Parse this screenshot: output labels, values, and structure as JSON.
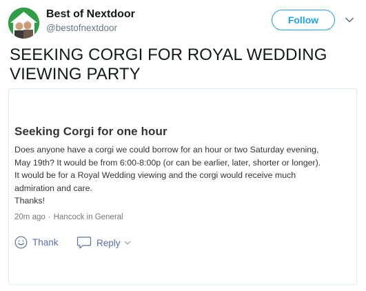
{
  "account": {
    "name": "Best of Nextdoor",
    "handle": "@bestofnextdoor",
    "follow_label": "Follow",
    "avatar_icon": "couple-photo-avatar",
    "caret_icon": "chevron-down-icon"
  },
  "tweet": {
    "text": "SEEKING CORGI FOR ROYAL WEDDING VIEWING PARTY"
  },
  "post": {
    "title": "Seeking Corgi for one hour",
    "body_lines": [
      "Does anyone have a corgi we could borrow for an hour or two Saturday evening,",
      "May 19th? It would be from 6:00-8:00p (or can be earlier, later, shorter or longer).",
      "It would be for a Royal Wedding viewing and the corgi would receive much",
      "admiration and care.",
      "Thanks!"
    ],
    "time": "20m ago",
    "separator": "·",
    "location": "Hancock in General",
    "thank_label": "Thank",
    "reply_label": "Reply",
    "thank_icon": "smiley-icon",
    "reply_icon": "speech-bubble-icon"
  },
  "colors": {
    "twitter_blue": "#1da1f2",
    "nextdoor_action": "#5a6da8",
    "avatar_green": "#2f9e46"
  }
}
